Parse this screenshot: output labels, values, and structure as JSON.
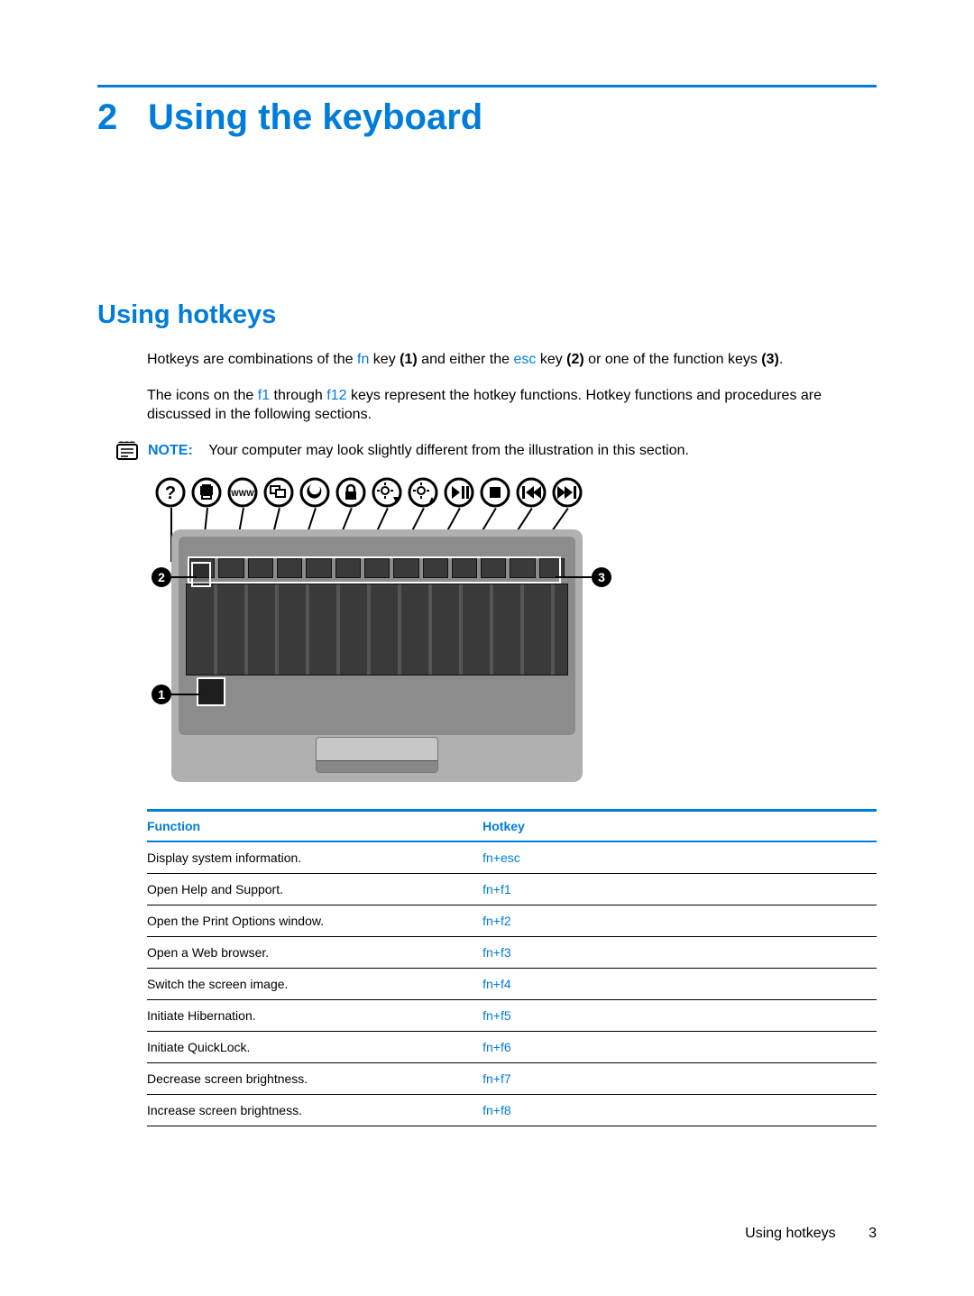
{
  "chapter_number": "2",
  "chapter_title": "Using the keyboard",
  "section_title": "Using hotkeys",
  "para1": {
    "t0": "Hotkeys are combinations of the ",
    "fn": "fn",
    "t1": " key ",
    "b1": "(1)",
    "t2": " and either the ",
    "esc": "esc",
    "t3": " key ",
    "b2": "(2)",
    "t4": " or one of the function keys ",
    "b3": "(3)",
    "t5": "."
  },
  "para2": {
    "t0": "The icons on the ",
    "f1": "f1",
    "t1": " through ",
    "f12": "f12",
    "t2": " keys represent the hotkey functions. Hotkey functions and procedures are discussed in the following sections."
  },
  "note": {
    "label": "NOTE:",
    "text": "Your computer may look slightly different from the illustration in this section."
  },
  "callouts": {
    "one": "1",
    "two": "2",
    "three": "3"
  },
  "table": {
    "col_function": "Function",
    "col_hotkey": "Hotkey",
    "rows": [
      {
        "function": "Display system information.",
        "hotkey": "fn+esc"
      },
      {
        "function": "Open Help and Support.",
        "hotkey": "fn+f1"
      },
      {
        "function": "Open the Print Options window.",
        "hotkey": "fn+f2"
      },
      {
        "function": "Open a Web browser.",
        "hotkey": "fn+f3"
      },
      {
        "function": "Switch the screen image.",
        "hotkey": "fn+f4"
      },
      {
        "function": "Initiate Hibernation.",
        "hotkey": "fn+f5"
      },
      {
        "function": "Initiate QuickLock.",
        "hotkey": "fn+f6"
      },
      {
        "function": "Decrease screen brightness.",
        "hotkey": "fn+f7"
      },
      {
        "function": "Increase screen brightness.",
        "hotkey": "fn+f8"
      }
    ]
  },
  "footer": {
    "section": "Using hotkeys",
    "page": "3"
  }
}
